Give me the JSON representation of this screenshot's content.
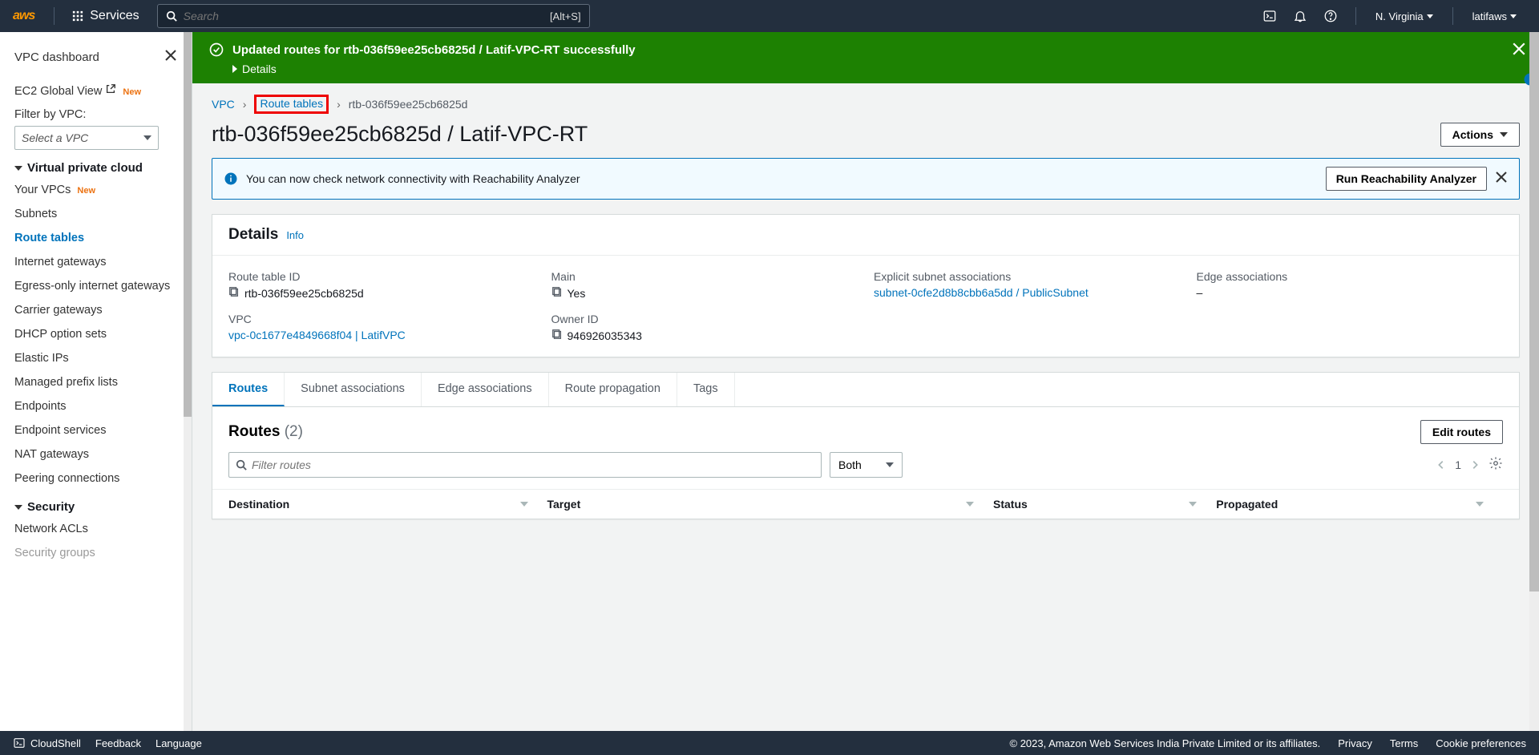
{
  "topnav": {
    "logo": "aws",
    "services": "Services",
    "search_placeholder": "Search",
    "search_shortcut": "[Alt+S]",
    "region": "N. Virginia",
    "user": "latifaws"
  },
  "sidebar": {
    "dashboard": "VPC dashboard",
    "ec2_global": "EC2 Global View",
    "new_badge": "New",
    "filter_label": "Filter by VPC:",
    "select_placeholder": "Select a VPC",
    "group_vpc": "Virtual private cloud",
    "items_vpc": {
      "your_vpcs": "Your VPCs",
      "subnets": "Subnets",
      "route_tables": "Route tables",
      "igw": "Internet gateways",
      "egress": "Egress-only internet gateways",
      "carrier": "Carrier gateways",
      "dhcp": "DHCP option sets",
      "eips": "Elastic IPs",
      "prefix": "Managed prefix lists",
      "endpoints": "Endpoints",
      "endpoint_svcs": "Endpoint services",
      "nat": "NAT gateways",
      "peering": "Peering connections"
    },
    "group_security": "Security",
    "items_security": {
      "nacls": "Network ACLs",
      "sgs": "Security groups"
    }
  },
  "flash": {
    "message": "Updated routes for rtb-036f59ee25cb6825d / Latif-VPC-RT successfully",
    "details": "Details"
  },
  "breadcrumbs": {
    "vpc": "VPC",
    "route_tables": "Route tables",
    "current": "rtb-036f59ee25cb6825d"
  },
  "page": {
    "title": "rtb-036f59ee25cb6825d / Latif-VPC-RT",
    "actions": "Actions"
  },
  "reach_banner": {
    "text": "You can now check network connectivity with Reachability Analyzer",
    "button": "Run Reachability Analyzer"
  },
  "details_panel": {
    "title": "Details",
    "info": "Info",
    "rtid_label": "Route table ID",
    "rtid_value": "rtb-036f59ee25cb6825d",
    "main_label": "Main",
    "main_value": "Yes",
    "explicit_label": "Explicit subnet associations",
    "explicit_value": "subnet-0cfe2d8b8cbb6a5dd / PublicSubnet",
    "edge_label": "Edge associations",
    "edge_value": "–",
    "vpc_label": "VPC",
    "vpc_value": "vpc-0c1677e4849668f04 | LatifVPC",
    "owner_label": "Owner ID",
    "owner_value": "946926035343"
  },
  "tabs": {
    "routes": "Routes",
    "subnet_assoc": "Subnet associations",
    "edge_assoc": "Edge associations",
    "route_prop": "Route propagation",
    "tags": "Tags"
  },
  "routes_section": {
    "title": "Routes",
    "count": "(2)",
    "edit": "Edit routes",
    "filter_placeholder": "Filter routes",
    "selector": "Both",
    "page": "1",
    "cols": {
      "destination": "Destination",
      "target": "Target",
      "status": "Status",
      "propagated": "Propagated"
    }
  },
  "footer": {
    "cloudshell": "CloudShell",
    "feedback": "Feedback",
    "language": "Language",
    "copyright": "© 2023, Amazon Web Services India Private Limited or its affiliates.",
    "privacy": "Privacy",
    "terms": "Terms",
    "cookies": "Cookie preferences"
  }
}
